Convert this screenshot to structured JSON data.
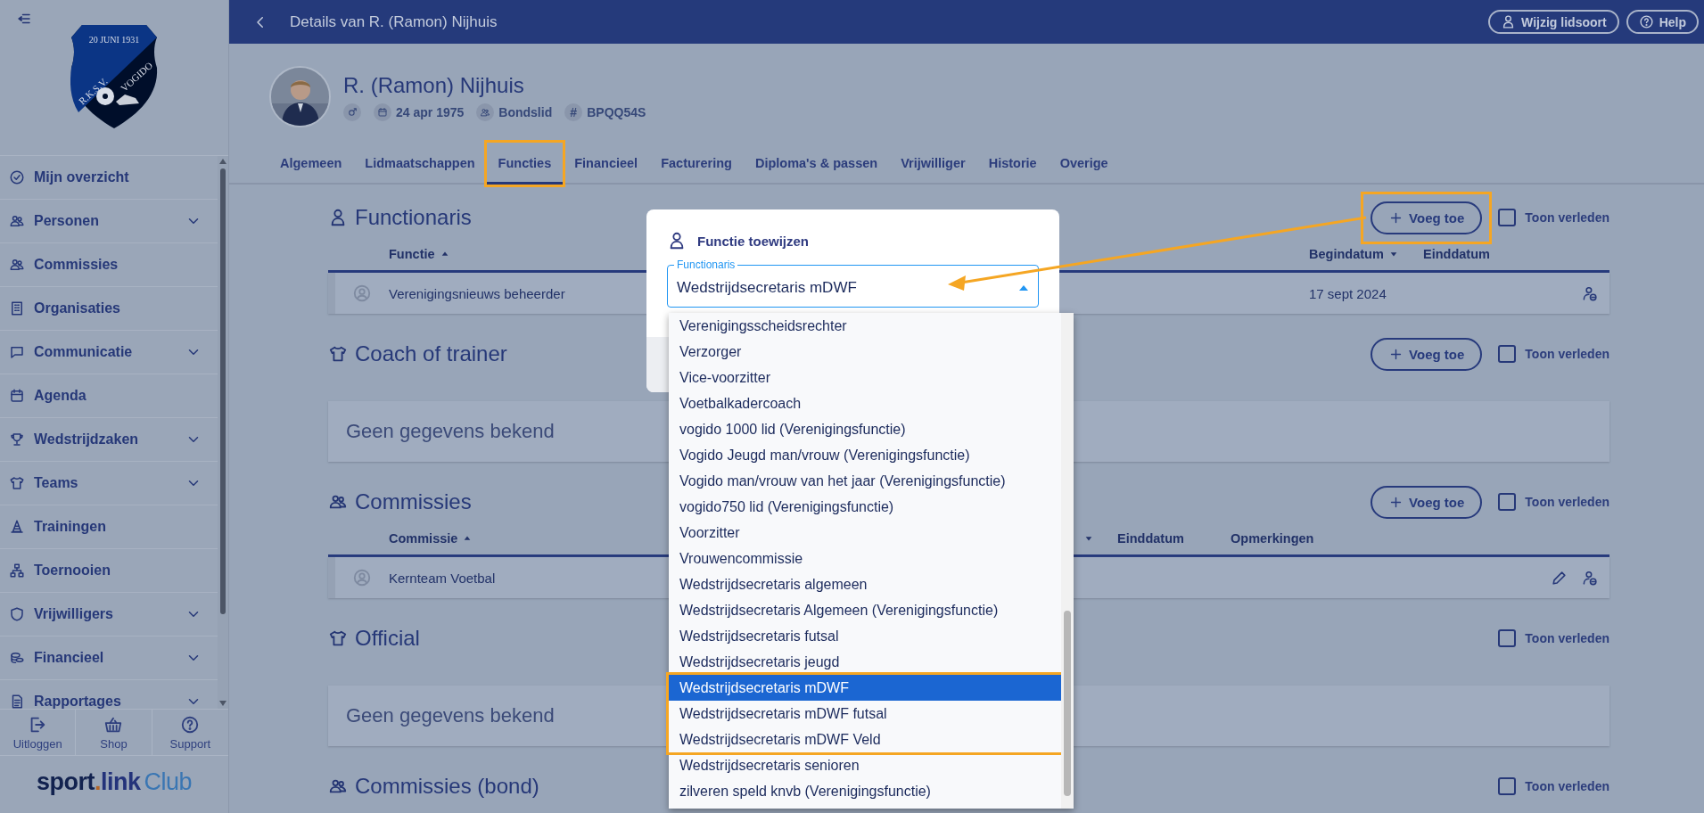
{
  "sidebar": {
    "logo": {
      "top": "20 JUNI 1931",
      "left": "R.K.S.V.",
      "right": "VOGIDO"
    },
    "items": [
      {
        "label": "Mijn overzicht",
        "expandable": false
      },
      {
        "label": "Personen",
        "expandable": true
      },
      {
        "label": "Commissies",
        "expandable": false
      },
      {
        "label": "Organisaties",
        "expandable": false
      },
      {
        "label": "Communicatie",
        "expandable": true
      },
      {
        "label": "Agenda",
        "expandable": false
      },
      {
        "label": "Wedstrijdzaken",
        "expandable": true
      },
      {
        "label": "Teams",
        "expandable": true
      },
      {
        "label": "Trainingen",
        "expandable": false
      },
      {
        "label": "Toernooien",
        "expandable": false
      },
      {
        "label": "Vrijwilligers",
        "expandable": true
      },
      {
        "label": "Financieel",
        "expandable": true
      },
      {
        "label": "Rapportages",
        "expandable": true
      }
    ],
    "footer_buttons": [
      "Uitloggen",
      "Shop",
      "Support"
    ],
    "brand": [
      "sport",
      ".",
      "link",
      "Club"
    ]
  },
  "header": {
    "title": "Details van R. (Ramon) Nijhuis",
    "buttons": [
      "Wijzig lidsoort",
      "Help"
    ]
  },
  "profile": {
    "name": "R. (Ramon) Nijhuis",
    "birthdate": "24 apr 1975",
    "membership": "Bondslid",
    "id_symbol": "#",
    "relation_code": "BPQQ54S"
  },
  "tabs": [
    {
      "label": "Algemeen",
      "selected": false,
      "highlighted": false
    },
    {
      "label": "Lidmaatschappen",
      "selected": false,
      "highlighted": false
    },
    {
      "label": "Functies",
      "selected": true,
      "highlighted": true
    },
    {
      "label": "Financieel",
      "selected": false,
      "highlighted": false
    },
    {
      "label": "Facturering",
      "selected": false,
      "highlighted": false
    },
    {
      "label": "Diploma's & passen",
      "selected": false,
      "highlighted": false
    },
    {
      "label": "Vrijwilliger",
      "selected": false,
      "highlighted": false
    },
    {
      "label": "Historie",
      "selected": false,
      "highlighted": false
    },
    {
      "label": "Overige",
      "selected": false,
      "highlighted": false
    }
  ],
  "sections": [
    {
      "kind": "table",
      "title": "Functionaris",
      "add_button": {
        "label": "Voeg toe",
        "highlighted": true
      },
      "show_past": {
        "label": "Toon verleden",
        "checked": false
      },
      "columns": [
        {
          "label": "Functie",
          "sort_ascending": true
        },
        {
          "label": "Begindatum",
          "sort_ascending": false
        },
        {
          "label": "Einddatum"
        }
      ],
      "rows": [
        {
          "cells": [
            "Verenigingsnieuws beheerder",
            "17 sept 2024"
          ],
          "editable": false,
          "removable": true
        }
      ]
    },
    {
      "kind": "empty",
      "title": "Coach of trainer",
      "add_button": {
        "label": "Voeg toe",
        "highlighted": false
      },
      "show_past": {
        "label": "Toon verleden",
        "checked": false
      },
      "empty_text": "Geen gegevens bekend"
    },
    {
      "kind": "table",
      "title": "Commissies",
      "add_button": {
        "label": "Voeg toe",
        "highlighted": false
      },
      "show_past": {
        "label": "Toon verleden",
        "checked": false
      },
      "columns": [
        {
          "label": "Commissie",
          "sort_ascending": true
        },
        {
          "sort_ascending": false
        },
        {
          "label": "Einddatum"
        },
        {
          "label": "Opmerkingen"
        }
      ],
      "rows": [
        {
          "cells": [
            "Kernteam Voetbal"
          ],
          "editable": true,
          "removable": true
        }
      ]
    },
    {
      "kind": "empty",
      "title": "Official",
      "show_past": {
        "label": "Toon verleden",
        "checked": false
      },
      "empty_text": "Geen gegevens bekend"
    },
    {
      "kind": "heading",
      "title": "Commissies (bond)",
      "show_past": {
        "label": "Toon verleden",
        "checked": false
      }
    }
  ],
  "dialog": {
    "title": "Functie toewijzen",
    "field": {
      "label": "Functionaris",
      "value": "Wedstrijdsecretaris mDWF"
    },
    "options": [
      {
        "label": "Verenigingsscheidsrechter",
        "selected": false,
        "highlighted": false
      },
      {
        "label": "Verzorger",
        "selected": false,
        "highlighted": false
      },
      {
        "label": "Vice-voorzitter",
        "selected": false,
        "highlighted": false
      },
      {
        "label": "Voetbalkadercoach",
        "selected": false,
        "highlighted": false
      },
      {
        "label": "vogido 1000 lid (Verenigingsfunctie)",
        "selected": false,
        "highlighted": false
      },
      {
        "label": "Vogido Jeugd man/vrouw (Verenigingsfunctie)",
        "selected": false,
        "highlighted": false
      },
      {
        "label": "Vogido man/vrouw van het jaar (Verenigingsfunctie)",
        "selected": false,
        "highlighted": false
      },
      {
        "label": "vogido750 lid (Verenigingsfunctie)",
        "selected": false,
        "highlighted": false
      },
      {
        "label": "Voorzitter",
        "selected": false,
        "highlighted": false
      },
      {
        "label": "Vrouwencommissie",
        "selected": false,
        "highlighted": false
      },
      {
        "label": "Wedstrijdsecretaris algemeen",
        "selected": false,
        "highlighted": false
      },
      {
        "label": "Wedstrijdsecretaris Algemeen (Verenigingsfunctie)",
        "selected": false,
        "highlighted": false
      },
      {
        "label": "Wedstrijdsecretaris futsal",
        "selected": false,
        "highlighted": false
      },
      {
        "label": "Wedstrijdsecretaris jeugd",
        "selected": false,
        "highlighted": false
      },
      {
        "label": "Wedstrijdsecretaris mDWF",
        "selected": true,
        "highlighted": true
      },
      {
        "label": "Wedstrijdsecretaris mDWF futsal",
        "selected": false,
        "highlighted": true
      },
      {
        "label": "Wedstrijdsecretaris mDWF Veld",
        "selected": false,
        "highlighted": true
      },
      {
        "label": "Wedstrijdsecretaris senioren",
        "selected": false,
        "highlighted": false
      },
      {
        "label": "zilveren speld knvb (Verenigingsfunctie)",
        "selected": false,
        "highlighted": false
      }
    ]
  }
}
